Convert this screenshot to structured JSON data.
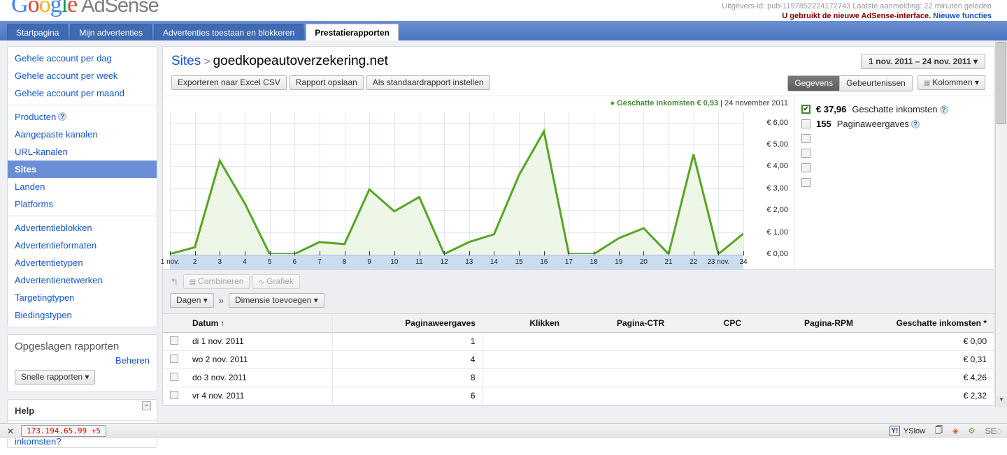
{
  "header": {
    "logo_text": "Google",
    "product_name": "AdSense",
    "publisher_line": "Uitgevers-id: pub-1197852224172743   Laatste aanmelding: 22 minuten geleden",
    "notice_text": "U gebruikt de nieuwe AdSense-interface.",
    "notice_link": "Nieuwe functies"
  },
  "tabs": [
    {
      "label": "Startpagina",
      "active": false
    },
    {
      "label": "Mijn advertenties",
      "active": false
    },
    {
      "label": "Advertenties toestaan en blokkeren",
      "active": false
    },
    {
      "label": "Prestatierapporten",
      "active": true
    }
  ],
  "sidebar": {
    "groups": [
      {
        "items": [
          {
            "label": "Gehele account per dag",
            "selected": false
          },
          {
            "label": "Gehele account per week",
            "selected": false
          },
          {
            "label": "Gehele account per maand",
            "selected": false
          }
        ]
      },
      {
        "items": [
          {
            "label": "Producten",
            "selected": false,
            "help": true
          },
          {
            "label": "Aangepaste kanalen",
            "selected": false
          },
          {
            "label": "URL-kanalen",
            "selected": false
          },
          {
            "label": "Sites",
            "selected": true
          },
          {
            "label": "Landen",
            "selected": false
          },
          {
            "label": "Platforms",
            "selected": false
          }
        ]
      },
      {
        "items": [
          {
            "label": "Advertentieblokken",
            "selected": false
          },
          {
            "label": "Advertentieformaten",
            "selected": false
          },
          {
            "label": "Advertentietypen",
            "selected": false
          },
          {
            "label": "Advertentienetwerken",
            "selected": false
          },
          {
            "label": "Targetingtypen",
            "selected": false
          },
          {
            "label": "Biedingstypen",
            "selected": false
          }
        ]
      }
    ],
    "saved_reports": {
      "title": "Opgeslagen rapporten",
      "manage_label": "Beheren",
      "dropdown_label": "Snelle rapporten"
    },
    "help": {
      "title": "Help",
      "collapse_icon": "−",
      "links": [
        "Waarom zie ik klikken zonder inkomsten?"
      ]
    }
  },
  "main": {
    "breadcrumb_root": "Sites",
    "breadcrumb_sep": ">",
    "breadcrumb_current": "goedkopeautoverzekering.net",
    "buttons": [
      "Exporteren naar Excel CSV",
      "Rapport opslaan",
      "Als standaardrapport instellen"
    ],
    "date_range": "1 nov. 2011 – 24 nov. 2011",
    "date_range_caret": "▾",
    "view_toggle": [
      {
        "label": "Gegevens",
        "active": true
      },
      {
        "label": "Gebeurtenissen",
        "active": false
      }
    ],
    "columns_button": "Kolommen",
    "columns_caret": "▾",
    "columns_icon": "grid-icon"
  },
  "chart_tooltip": {
    "dot": "●",
    "series": "Geschatte inkomsten",
    "value": "€ 0,93",
    "divider": "|",
    "date": "24 november 2011"
  },
  "legend": [
    {
      "checked": true,
      "value": "€ 37,96",
      "name": "Geschatte inkomsten",
      "help": true
    },
    {
      "checked": false,
      "value": "155",
      "name": "Paginaweergaves",
      "help": true
    },
    {
      "checked": false,
      "value": "",
      "name": "",
      "help": false
    },
    {
      "checked": false,
      "value": "",
      "name": "",
      "help": false
    },
    {
      "checked": false,
      "value": "",
      "name": "",
      "help": false
    },
    {
      "checked": false,
      "value": "",
      "name": "",
      "help": false
    }
  ],
  "chart_data": {
    "type": "area",
    "title": "Geschatte inkomsten",
    "xlabel": "",
    "ylabel": "Geschatte inkomsten (€)",
    "ylim": [
      0,
      6.5
    ],
    "yticks": [
      0,
      1,
      2,
      3,
      4,
      5,
      6
    ],
    "ytick_labels": [
      "€ 0,00",
      "€ 1,00",
      "€ 2,00",
      "€ 3,00",
      "€ 4,00",
      "€ 5,00",
      "€ 6,00"
    ],
    "grid": true,
    "legend_position": "right",
    "line_color": "#58a522",
    "fill_color": "#eef6e7",
    "categories": [
      "1 nov.",
      "2",
      "3",
      "4",
      "5",
      "6",
      "7",
      "8",
      "9",
      "10",
      "11",
      "12",
      "13",
      "14",
      "15",
      "16",
      "17",
      "18",
      "19",
      "20",
      "21",
      "22",
      "23 nov.",
      "24"
    ],
    "series": [
      {
        "name": "Geschatte inkomsten",
        "values": [
          0.0,
          0.31,
          4.26,
          2.32,
          0.0,
          0.0,
          0.55,
          0.45,
          2.95,
          1.95,
          2.6,
          0.0,
          0.55,
          0.9,
          3.6,
          5.6,
          0.0,
          0.0,
          0.72,
          1.18,
          0.0,
          4.55,
          0.0,
          0.93
        ]
      }
    ]
  },
  "chart_toolbar": {
    "undo_icon": "undo-icon",
    "combine_label": "Combineren",
    "combine_icon": "bars-icon",
    "graph_label": "Grafiek",
    "graph_icon": "chart-icon",
    "granularity_label": "Dagen",
    "granularity_caret": "▾",
    "chevron": "»",
    "add_dimension_label": "Dimensie toevoegen",
    "add_dimension_caret": "▾"
  },
  "table": {
    "columns": [
      {
        "label": "Datum",
        "sort": "↑",
        "align": "left"
      },
      {
        "label": "Paginaweergaves",
        "align": "right"
      },
      {
        "label": "Klikken",
        "align": "right"
      },
      {
        "label": "Pagina-CTR",
        "align": "right"
      },
      {
        "label": "CPC",
        "align": "right"
      },
      {
        "label": "Pagina-RPM",
        "align": "right"
      },
      {
        "label": "Geschatte inkomsten *",
        "align": "right"
      }
    ],
    "rows": [
      {
        "date": "di 1 nov. 2011",
        "pageviews": "1",
        "clicks": "",
        "page_ctr": "",
        "cpc": "",
        "page_rpm": "",
        "earnings": "€ 0,00"
      },
      {
        "date": "wo 2 nov. 2011",
        "pageviews": "4",
        "clicks": "",
        "page_ctr": "",
        "cpc": "",
        "page_rpm": "",
        "earnings": "€ 0,31"
      },
      {
        "date": "do 3 nov. 2011",
        "pageviews": "8",
        "clicks": "",
        "page_ctr": "",
        "cpc": "",
        "page_rpm": "",
        "earnings": "€ 4,26"
      },
      {
        "date": "vr 4 nov. 2011",
        "pageviews": "6",
        "clicks": "",
        "page_ctr": "",
        "cpc": "",
        "page_rpm": "",
        "earnings": "€ 2,32"
      }
    ]
  },
  "status_bar": {
    "close_icon": "✕",
    "ip_text": "173.194.65.99 +5",
    "yslow_label": "YSlow",
    "seo_label": "SE"
  }
}
